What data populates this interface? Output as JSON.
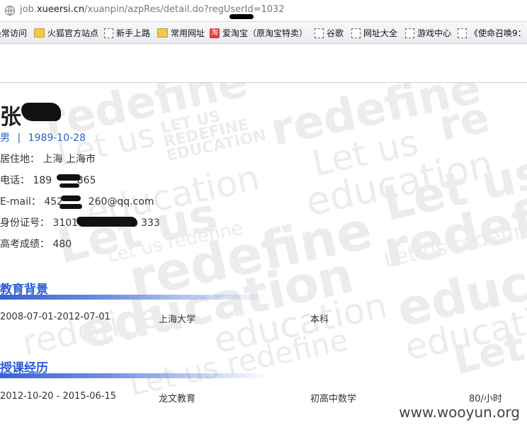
{
  "browser": {
    "url_prefix": "job.",
    "url_domain": "xueersi.cn",
    "url_path": "/xuanpin/azpRes/detail.do?regUserId=1032"
  },
  "bookmarks": [
    {
      "label": "最常访问",
      "icon": "page-icon"
    },
    {
      "label": "火狐官方站点",
      "icon": "folder-icon"
    },
    {
      "label": "新手上路",
      "icon": "page-icon"
    },
    {
      "label": "常用网址",
      "icon": "folder-icon"
    },
    {
      "label": "爱淘宝（原淘宝特卖）",
      "icon": "taobao-icon"
    },
    {
      "label": "谷歌",
      "icon": "page-icon"
    },
    {
      "label": "网址大全",
      "icon": "page-icon"
    },
    {
      "label": "游戏中心",
      "icon": "page-icon"
    },
    {
      "label": "《使命召唤9：",
      "icon": "page-icon"
    }
  ],
  "profile": {
    "name": "张",
    "gender": "男",
    "separator": "|",
    "birthdate": "1989-10-28",
    "residence_label": "居住地：",
    "residence_value": "上海  上海市",
    "phone_label": "电话：",
    "phone_value": "189        865",
    "email_label": "E-mail：",
    "email_value": "452        260@qq.com",
    "id_label": "身份证号：",
    "id_value": "3101                    333",
    "score_label": "高考成绩：",
    "score_value": "480"
  },
  "education": {
    "title": "教育背景",
    "rows": [
      {
        "period": "2008-07-01-2012-07-01",
        "school": "上海大学",
        "degree": "本科"
      }
    ]
  },
  "teaching": {
    "title": "授课经历",
    "rows": [
      {
        "period": "2012-10-20 - 2015-06-15",
        "org": "龙文教育",
        "subject": "初高中数学",
        "hours": "80/小时"
      }
    ]
  },
  "watermark_text": "www.wooyun.org",
  "colors": {
    "link_blue": "#2b62c4",
    "section_blue": "#2a5bd7",
    "watermark_gray": "#ececec"
  }
}
